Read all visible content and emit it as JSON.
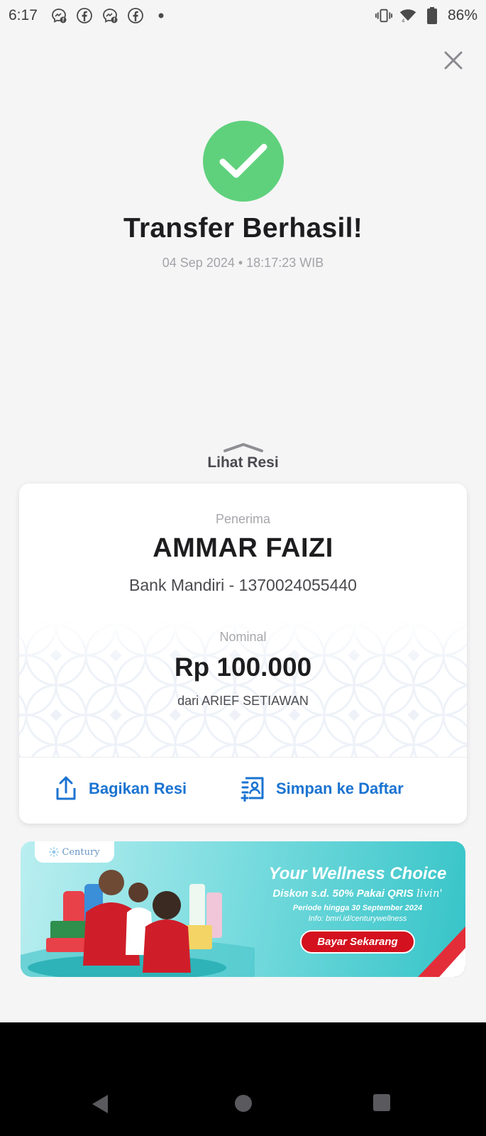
{
  "status_bar": {
    "time": "6:17",
    "battery": "86%",
    "icons_left": [
      "messenger-icon",
      "facebook-icon",
      "messenger-icon",
      "facebook-icon",
      "dot-icon"
    ],
    "icons_right": [
      "vibrate-icon",
      "wifi-4-icon",
      "battery-icon"
    ]
  },
  "header": {
    "close_icon": "close-icon"
  },
  "result": {
    "icon": "checkmark-icon",
    "title": "Transfer Berhasil!",
    "datetime": "04 Sep 2024 • 18:17:23 WIB"
  },
  "receipt": {
    "toggle_label": "Lihat Resi",
    "recipient_label": "Penerima",
    "recipient_name": "AMMAR FAIZI",
    "recipient_account": "Bank Mandiri - 1370024055440",
    "amount_label": "Nominal",
    "amount": "Rp 100.000",
    "sender": "dari ARIEF SETIAWAN",
    "actions": {
      "share_label": "Bagikan Resi",
      "save_label": "Simpan ke Daftar"
    }
  },
  "banner": {
    "brand": "Century",
    "title": "Your Wellness Choice",
    "subtitle": "Diskon s.d. 50% Pakai QRIS",
    "subtitle_brand": "livin'",
    "period": "Periode hingga 30 September 2024",
    "info": "Info: bmri.id/centurywellness",
    "cta": "Bayar Sekarang"
  },
  "colors": {
    "success": "#5fd17c",
    "accent_blue": "#1a73d1",
    "background": "#f5f5f6",
    "banner_cta": "#d4111e"
  }
}
